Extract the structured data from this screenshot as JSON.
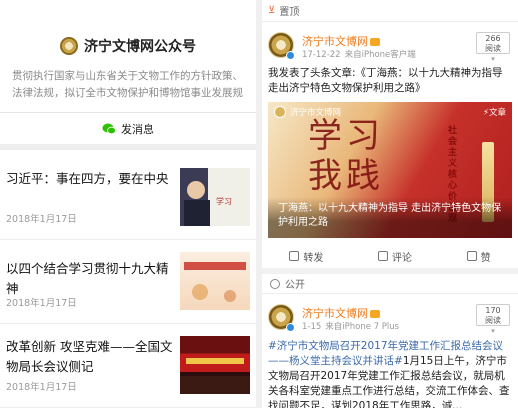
{
  "left": {
    "account_name": "济宁文博网公众号",
    "description": "贯彻执行国家与山东省关于文物工作的方针政策、法律法规，拟订全市文物保护和博物馆事业发展规划...",
    "send_message_label": "发消息",
    "icons": {
      "logo": "museum-logo",
      "message": "wechat-icon"
    },
    "articles": [
      {
        "title": "习近平：事在四方，要在中央",
        "date": "2018年1月17日"
      },
      {
        "title": "以四个结合学习贯彻十九大精神",
        "date": "2018年1月17日"
      },
      {
        "title": "改革创新 攻坚克难——全国文物局长会议侧记",
        "date": "2018年1月17日"
      }
    ]
  },
  "right": {
    "pinned_label": "置顶",
    "post1": {
      "username": "济宁市文博网",
      "time": "17-12-22",
      "source": "来自iPhone客户端",
      "read_count": "266",
      "read_label": "阅读",
      "text": "我发表了头条文章:《丁海燕：以十九大精神为指导 走出济宁特色文物保护利用之路》",
      "card": {
        "brand": "济宁市文博网",
        "tag": "⚡文章",
        "calligraphy": "学习 我践",
        "side_text": "社会主义核心价值观",
        "caption": "丁海燕：以十九大精神为指导 走出济宁特色文物保护利用之路"
      }
    },
    "actions": {
      "repost": "转发",
      "comment": "评论",
      "like": "赞"
    },
    "public_label": "公开",
    "post2": {
      "username": "济宁市文博网",
      "time": "1-15",
      "source": "来自iPhone 7 Plus",
      "read_count": "170",
      "read_label": "阅读",
      "hashtag": "#济宁市文物局召开2017年党建工作汇报总结会议——杨义堂主持会议并讲话#",
      "text": "1月15日上午，济宁市文物局召开2017年党建工作汇报总结会议，就局机关各科室党建重点工作进行总结，交流工作体会、查找问题不足，谋划2018年工作思路，诚..."
    }
  }
}
